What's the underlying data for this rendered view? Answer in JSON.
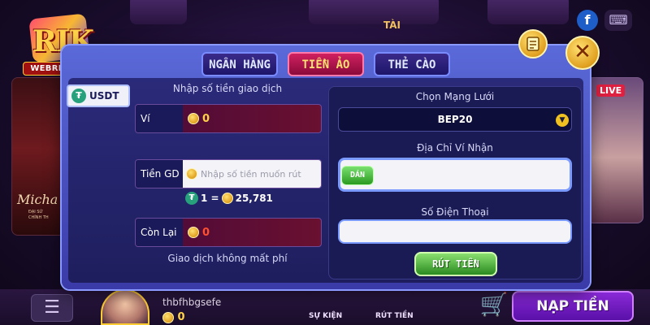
{
  "branding": {
    "logo_text": "RIK",
    "website": "WEBRIKVIP.NET"
  },
  "background": {
    "left_card": {
      "name": "Micha",
      "sub1": "ĐẠI SỨ",
      "sub2": "CHÍNH TH"
    },
    "live_badge": "LIVE",
    "top_game_label": "TÀI",
    "bottom_bar": {
      "username": "thbfhbgsefe",
      "coins": "0",
      "events_label": "SỰ KIỆN",
      "withdraw_label": "RÚT TIỀN",
      "deposit_label": "NẠP TIỀN"
    }
  },
  "modal": {
    "tabs": [
      {
        "label": "NGÂN HÀNG",
        "active": false
      },
      {
        "label": "TIỀN ẢO",
        "active": true
      },
      {
        "label": "THẺ CÀO",
        "active": false
      }
    ],
    "currency_button": "USDT",
    "left": {
      "title": "Nhập số tiền giao dịch",
      "wallet_label": "Ví",
      "wallet_value": "0",
      "amount_label": "Tiền GD",
      "amount_placeholder": "Nhập số tiền muốn rút",
      "rate_prefix": "1 =",
      "rate_value": "25,781",
      "remaining_label": "Còn Lại",
      "remaining_value": "0",
      "fee_note": "Giao dịch không mất phí"
    },
    "right": {
      "network_label": "Chọn Mạng Lưới",
      "network_value": "BEP20",
      "address_label": "Địa Chỉ Ví Nhận",
      "address_value": "",
      "paste_button": "DÁN",
      "phone_label": "Số Điện Thoại",
      "phone_value": "",
      "submit_button": "RÚT TIỀN"
    }
  },
  "colors": {
    "active_tab": "#d02060",
    "tab": "#1e166a",
    "panel": "#1e1e5e",
    "accent_gold": "#ffd24a",
    "green_button": "#2a8a20"
  },
  "icons": [
    "tether-icon",
    "coin-icon",
    "close-icon",
    "history-icon",
    "dropdown-arrow-icon",
    "menu-icon",
    "cart-icon",
    "facebook-icon",
    "gamepad-icon"
  ]
}
